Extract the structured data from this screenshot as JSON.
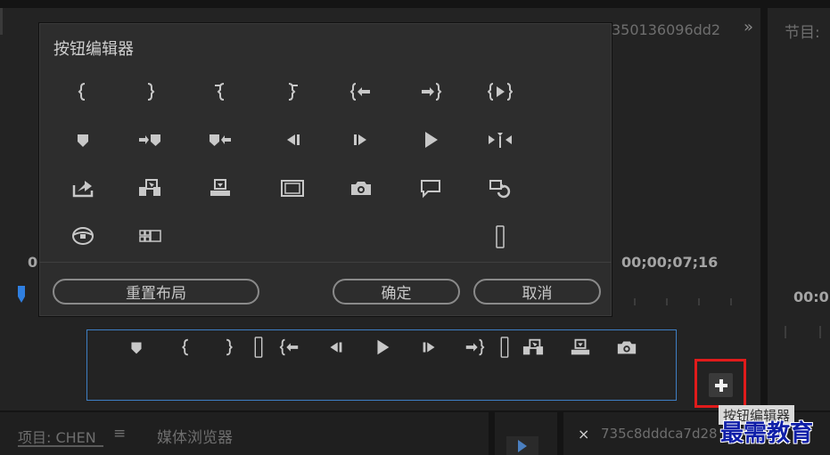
{
  "background": {
    "source_id_text": "350136096dd2",
    "expand_glyph": "»",
    "program_panel_title": "节目:",
    "left_timecode_partial": "0",
    "source_timecode": "00;00;07;16",
    "program_timecode_partial": "00:0"
  },
  "dialog": {
    "title": "按钮编辑器",
    "rows": [
      [
        "mark-in-icon",
        "mark-out-icon",
        "clear-in-icon",
        "clear-out-icon",
        "go-to-in-icon",
        "go-to-out-icon",
        "play-in-to-out-icon"
      ],
      [
        "add-marker-icon",
        "go-to-next-marker-icon",
        "go-to-previous-marker-icon",
        "step-back-icon",
        "step-forward-icon",
        "play-icon",
        "trim-monitor-icon"
      ],
      [
        "lift-icon",
        "insert-icon",
        "overwrite-icon",
        "safe-margins-icon",
        "export-frame-icon",
        "comment-icon",
        "loop-icon"
      ],
      [
        "vr-video-icon",
        "multi-camera-icon",
        "spacer-icon"
      ]
    ],
    "reset_label": "重置布局",
    "ok_label": "确定",
    "cancel_label": "取消"
  },
  "button_bar": {
    "buttons": [
      "add-marker-icon",
      "mark-in-icon",
      "mark-out-icon",
      "spacer-icon",
      "go-to-in-icon",
      "step-back-icon",
      "play-icon",
      "step-forward-icon",
      "go-to-out-icon",
      "spacer-icon",
      "insert-icon",
      "overwrite-icon",
      "export-frame-icon"
    ]
  },
  "add_button": {
    "icon": "plus-icon",
    "tooltip": "按钮编辑器"
  },
  "bottom_bar": {
    "project_tab": "项目: CHEN",
    "menu_glyph": "≡",
    "media_browser_tab": "媒体浏览器",
    "close_glyph": "×",
    "sequence_name": "735c8dddca7d28"
  },
  "watermark": "最需教育",
  "colors": {
    "accent_blue": "#3e7fc4",
    "highlight_red": "#e01b1b",
    "playhead_blue": "#2f7fe0"
  }
}
